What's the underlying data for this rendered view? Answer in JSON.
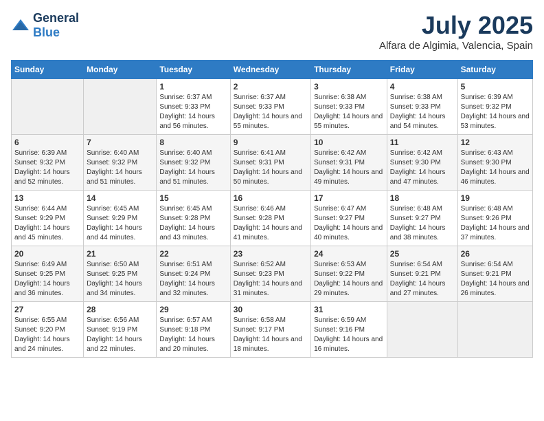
{
  "logo": {
    "general": "General",
    "blue": "Blue"
  },
  "title": "July 2025",
  "subtitle": "Alfara de Algimia, Valencia, Spain",
  "days_of_week": [
    "Sunday",
    "Monday",
    "Tuesday",
    "Wednesday",
    "Thursday",
    "Friday",
    "Saturday"
  ],
  "weeks": [
    [
      {
        "day": "",
        "sunrise": "",
        "sunset": "",
        "daylight": ""
      },
      {
        "day": "",
        "sunrise": "",
        "sunset": "",
        "daylight": ""
      },
      {
        "day": "1",
        "sunrise": "Sunrise: 6:37 AM",
        "sunset": "Sunset: 9:33 PM",
        "daylight": "Daylight: 14 hours and 56 minutes."
      },
      {
        "day": "2",
        "sunrise": "Sunrise: 6:37 AM",
        "sunset": "Sunset: 9:33 PM",
        "daylight": "Daylight: 14 hours and 55 minutes."
      },
      {
        "day": "3",
        "sunrise": "Sunrise: 6:38 AM",
        "sunset": "Sunset: 9:33 PM",
        "daylight": "Daylight: 14 hours and 55 minutes."
      },
      {
        "day": "4",
        "sunrise": "Sunrise: 6:38 AM",
        "sunset": "Sunset: 9:33 PM",
        "daylight": "Daylight: 14 hours and 54 minutes."
      },
      {
        "day": "5",
        "sunrise": "Sunrise: 6:39 AM",
        "sunset": "Sunset: 9:32 PM",
        "daylight": "Daylight: 14 hours and 53 minutes."
      }
    ],
    [
      {
        "day": "6",
        "sunrise": "Sunrise: 6:39 AM",
        "sunset": "Sunset: 9:32 PM",
        "daylight": "Daylight: 14 hours and 52 minutes."
      },
      {
        "day": "7",
        "sunrise": "Sunrise: 6:40 AM",
        "sunset": "Sunset: 9:32 PM",
        "daylight": "Daylight: 14 hours and 51 minutes."
      },
      {
        "day": "8",
        "sunrise": "Sunrise: 6:40 AM",
        "sunset": "Sunset: 9:32 PM",
        "daylight": "Daylight: 14 hours and 51 minutes."
      },
      {
        "day": "9",
        "sunrise": "Sunrise: 6:41 AM",
        "sunset": "Sunset: 9:31 PM",
        "daylight": "Daylight: 14 hours and 50 minutes."
      },
      {
        "day": "10",
        "sunrise": "Sunrise: 6:42 AM",
        "sunset": "Sunset: 9:31 PM",
        "daylight": "Daylight: 14 hours and 49 minutes."
      },
      {
        "day": "11",
        "sunrise": "Sunrise: 6:42 AM",
        "sunset": "Sunset: 9:30 PM",
        "daylight": "Daylight: 14 hours and 47 minutes."
      },
      {
        "day": "12",
        "sunrise": "Sunrise: 6:43 AM",
        "sunset": "Sunset: 9:30 PM",
        "daylight": "Daylight: 14 hours and 46 minutes."
      }
    ],
    [
      {
        "day": "13",
        "sunrise": "Sunrise: 6:44 AM",
        "sunset": "Sunset: 9:29 PM",
        "daylight": "Daylight: 14 hours and 45 minutes."
      },
      {
        "day": "14",
        "sunrise": "Sunrise: 6:45 AM",
        "sunset": "Sunset: 9:29 PM",
        "daylight": "Daylight: 14 hours and 44 minutes."
      },
      {
        "day": "15",
        "sunrise": "Sunrise: 6:45 AM",
        "sunset": "Sunset: 9:28 PM",
        "daylight": "Daylight: 14 hours and 43 minutes."
      },
      {
        "day": "16",
        "sunrise": "Sunrise: 6:46 AM",
        "sunset": "Sunset: 9:28 PM",
        "daylight": "Daylight: 14 hours and 41 minutes."
      },
      {
        "day": "17",
        "sunrise": "Sunrise: 6:47 AM",
        "sunset": "Sunset: 9:27 PM",
        "daylight": "Daylight: 14 hours and 40 minutes."
      },
      {
        "day": "18",
        "sunrise": "Sunrise: 6:48 AM",
        "sunset": "Sunset: 9:27 PM",
        "daylight": "Daylight: 14 hours and 38 minutes."
      },
      {
        "day": "19",
        "sunrise": "Sunrise: 6:48 AM",
        "sunset": "Sunset: 9:26 PM",
        "daylight": "Daylight: 14 hours and 37 minutes."
      }
    ],
    [
      {
        "day": "20",
        "sunrise": "Sunrise: 6:49 AM",
        "sunset": "Sunset: 9:25 PM",
        "daylight": "Daylight: 14 hours and 36 minutes."
      },
      {
        "day": "21",
        "sunrise": "Sunrise: 6:50 AM",
        "sunset": "Sunset: 9:25 PM",
        "daylight": "Daylight: 14 hours and 34 minutes."
      },
      {
        "day": "22",
        "sunrise": "Sunrise: 6:51 AM",
        "sunset": "Sunset: 9:24 PM",
        "daylight": "Daylight: 14 hours and 32 minutes."
      },
      {
        "day": "23",
        "sunrise": "Sunrise: 6:52 AM",
        "sunset": "Sunset: 9:23 PM",
        "daylight": "Daylight: 14 hours and 31 minutes."
      },
      {
        "day": "24",
        "sunrise": "Sunrise: 6:53 AM",
        "sunset": "Sunset: 9:22 PM",
        "daylight": "Daylight: 14 hours and 29 minutes."
      },
      {
        "day": "25",
        "sunrise": "Sunrise: 6:54 AM",
        "sunset": "Sunset: 9:21 PM",
        "daylight": "Daylight: 14 hours and 27 minutes."
      },
      {
        "day": "26",
        "sunrise": "Sunrise: 6:54 AM",
        "sunset": "Sunset: 9:21 PM",
        "daylight": "Daylight: 14 hours and 26 minutes."
      }
    ],
    [
      {
        "day": "27",
        "sunrise": "Sunrise: 6:55 AM",
        "sunset": "Sunset: 9:20 PM",
        "daylight": "Daylight: 14 hours and 24 minutes."
      },
      {
        "day": "28",
        "sunrise": "Sunrise: 6:56 AM",
        "sunset": "Sunset: 9:19 PM",
        "daylight": "Daylight: 14 hours and 22 minutes."
      },
      {
        "day": "29",
        "sunrise": "Sunrise: 6:57 AM",
        "sunset": "Sunset: 9:18 PM",
        "daylight": "Daylight: 14 hours and 20 minutes."
      },
      {
        "day": "30",
        "sunrise": "Sunrise: 6:58 AM",
        "sunset": "Sunset: 9:17 PM",
        "daylight": "Daylight: 14 hours and 18 minutes."
      },
      {
        "day": "31",
        "sunrise": "Sunrise: 6:59 AM",
        "sunset": "Sunset: 9:16 PM",
        "daylight": "Daylight: 14 hours and 16 minutes."
      },
      {
        "day": "",
        "sunrise": "",
        "sunset": "",
        "daylight": ""
      },
      {
        "day": "",
        "sunrise": "",
        "sunset": "",
        "daylight": ""
      }
    ]
  ]
}
